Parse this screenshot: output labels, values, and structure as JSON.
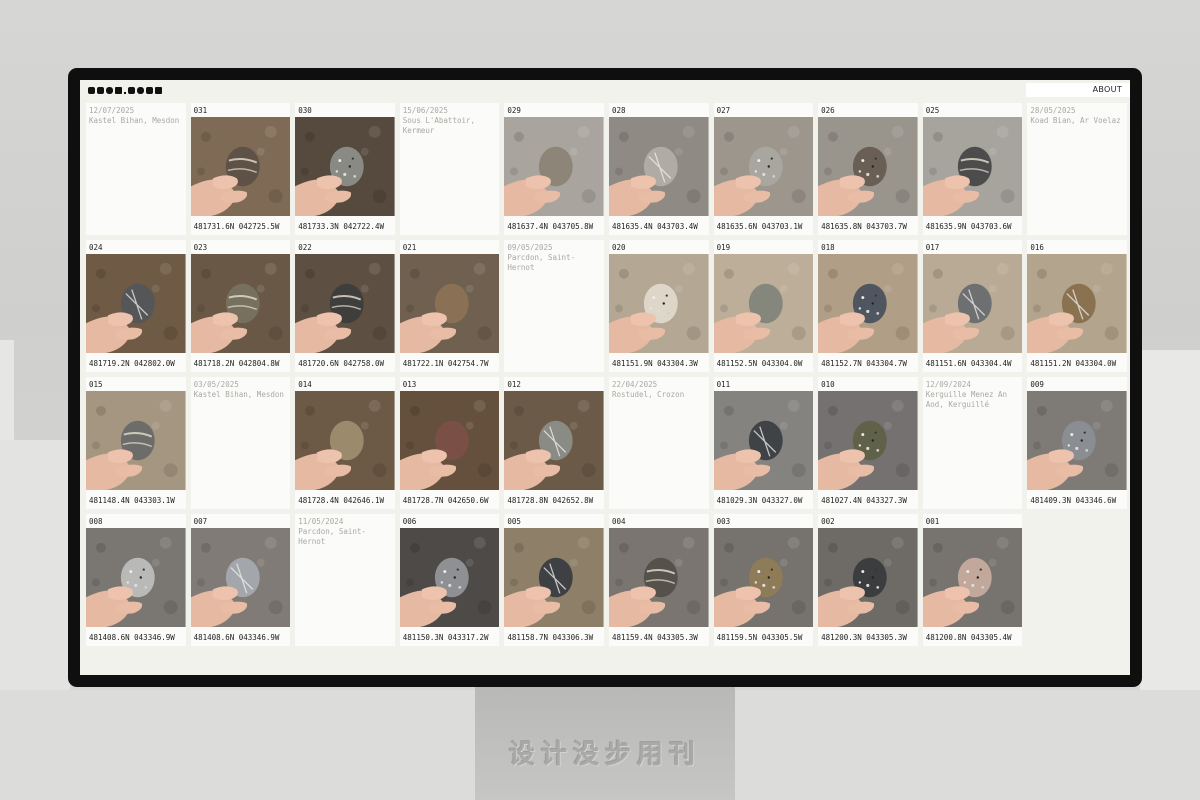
{
  "header": {
    "about_label": "ABOUT"
  },
  "watermark": "设计没步用刊",
  "colors": {
    "screen_bg": "#f2f2ed",
    "card_bg": "#fbfbf9",
    "muted_text": "#a8a8a4",
    "bezel": "#0f0f0f"
  },
  "cards": [
    {
      "kind": "info",
      "date": "12/07/2025",
      "place": "Kastel Bihan, Mesdon"
    },
    {
      "kind": "stone",
      "num": "031",
      "coords": "481731.6N 042725.5W",
      "ground": "#7e6a55",
      "stone": "#5e5246",
      "pattern": "stripe"
    },
    {
      "kind": "stone",
      "num": "030",
      "coords": "481733.3N 042722.4W",
      "ground": "#56493e",
      "stone": "#8a8a85",
      "pattern": "speck"
    },
    {
      "kind": "info",
      "date": "15/06/2025",
      "place": "Sous L'Abattoir, Kermeur"
    },
    {
      "kind": "stone",
      "num": "029",
      "coords": "481637.4N 043705.8W",
      "ground": "#a9a49d",
      "stone": "#8d8577",
      "pattern": "plain"
    },
    {
      "kind": "stone",
      "num": "028",
      "coords": "481635.4N 043703.4W",
      "ground": "#8f8a83",
      "stone": "#b0aca4",
      "pattern": "vein"
    },
    {
      "kind": "stone",
      "num": "027",
      "coords": "481635.6N 043703.1W",
      "ground": "#9c968d",
      "stone": "#a9a59f",
      "pattern": "speck"
    },
    {
      "kind": "stone",
      "num": "026",
      "coords": "481635.8N 043703.7W",
      "ground": "#99948c",
      "stone": "#6a5f55",
      "pattern": "speck"
    },
    {
      "kind": "stone",
      "num": "025",
      "coords": "481635.9N 043703.6W",
      "ground": "#a7a39d",
      "stone": "#4c4c4c",
      "pattern": "stripe"
    },
    {
      "kind": "info",
      "date": "28/05/2025",
      "place": "Koad Bian, Ar Voelaz"
    },
    {
      "kind": "stone",
      "num": "024",
      "coords": "481719.2N 042802.0W",
      "ground": "#6e5a45",
      "stone": "#545658",
      "pattern": "vein"
    },
    {
      "kind": "stone",
      "num": "023",
      "coords": "481718.2N 042804.8W",
      "ground": "#6a5846",
      "stone": "#77705e",
      "pattern": "stripe"
    },
    {
      "kind": "stone",
      "num": "022",
      "coords": "481720.6N 042758.0W",
      "ground": "#5d4f42",
      "stone": "#3e3e3c",
      "pattern": "stripe"
    },
    {
      "kind": "stone",
      "num": "021",
      "coords": "481722.1N 042754.7W",
      "ground": "#6f604f",
      "stone": "#8a7054",
      "pattern": "plain"
    },
    {
      "kind": "info",
      "date": "09/05/2025",
      "place": "Parcdon, Saint-Hernot"
    },
    {
      "kind": "stone",
      "num": "020",
      "coords": "481151.9N 043304.3W",
      "ground": "#b4a793",
      "stone": "#ded7c9",
      "pattern": "speck"
    },
    {
      "kind": "stone",
      "num": "019",
      "coords": "481152.5N 043304.0W",
      "ground": "#bcae98",
      "stone": "#86877c",
      "pattern": "plain"
    },
    {
      "kind": "stone",
      "num": "018",
      "coords": "481152.7N 043304.7W",
      "ground": "#b09f86",
      "stone": "#4f5660",
      "pattern": "speck"
    },
    {
      "kind": "stone",
      "num": "017",
      "coords": "481151.6N 043304.4W",
      "ground": "#b8aa94",
      "stone": "#6e6f70",
      "pattern": "vein"
    },
    {
      "kind": "stone",
      "num": "016",
      "coords": "481151.2N 043304.0W",
      "ground": "#b3a48d",
      "stone": "#8a7250",
      "pattern": "vein"
    },
    {
      "kind": "stone",
      "num": "015",
      "coords": "481148.4N 043303.1W",
      "ground": "#a49680",
      "stone": "#6c6d6b",
      "pattern": "stripe"
    },
    {
      "kind": "info",
      "date": "03/05/2025",
      "place": "Kastel Bihan, Mesdon"
    },
    {
      "kind": "stone",
      "num": "014",
      "coords": "481728.4N 042646.1W",
      "ground": "#6c5a46",
      "stone": "#9b8a6c",
      "pattern": "plain"
    },
    {
      "kind": "stone",
      "num": "013",
      "coords": "481728.7N 042650.6W",
      "ground": "#65503d",
      "stone": "#7a4f46",
      "pattern": "plain"
    },
    {
      "kind": "stone",
      "num": "012",
      "coords": "481728.8N 042652.8W",
      "ground": "#6b5a47",
      "stone": "#8a8b84",
      "pattern": "vein"
    },
    {
      "kind": "info",
      "date": "22/04/2025",
      "place": "Rostudel, Crozon"
    },
    {
      "kind": "stone",
      "num": "011",
      "coords": "481029.3N 043327.0W",
      "ground": "#858380",
      "stone": "#404346",
      "pattern": "vein"
    },
    {
      "kind": "stone",
      "num": "010",
      "coords": "481027.4N 043327.3W",
      "ground": "#747170",
      "stone": "#5f6148",
      "pattern": "speck"
    },
    {
      "kind": "info",
      "date": "12/09/2024",
      "place": "Kerguille Menez An Aod, Kerguillé"
    },
    {
      "kind": "stone",
      "num": "009",
      "coords": "481409.3N 043346.6W",
      "ground": "#7e7a76",
      "stone": "#8a8d92",
      "pattern": "speck"
    },
    {
      "kind": "stone",
      "num": "008",
      "coords": "481408.6N 043346.9W",
      "ground": "#7a7672",
      "stone": "#b9b9b7",
      "pattern": "speck"
    },
    {
      "kind": "stone",
      "num": "007",
      "coords": "481408.6N 043346.9W",
      "ground": "#807b76",
      "stone": "#a3a6ab",
      "pattern": "vein"
    },
    {
      "kind": "info",
      "date": "11/05/2024",
      "place": "Parcdon, Saint-Hernot"
    },
    {
      "kind": "stone",
      "num": "006",
      "coords": "481150.3N 043317.2W",
      "ground": "#4d4a47",
      "stone": "#8e9094",
      "pattern": "speck"
    },
    {
      "kind": "stone",
      "num": "005",
      "coords": "481158.7N 043306.3W",
      "ground": "#8e7f68",
      "stone": "#3f4044",
      "pattern": "vein"
    },
    {
      "kind": "stone",
      "num": "004",
      "coords": "481159.4N 043305.3W",
      "ground": "#7a7570",
      "stone": "#55524c",
      "pattern": "stripe"
    },
    {
      "kind": "stone",
      "num": "003",
      "coords": "481159.5N 043305.5W",
      "ground": "#76726d",
      "stone": "#8e7b58",
      "pattern": "speck"
    },
    {
      "kind": "stone",
      "num": "002",
      "coords": "481200.3N 043305.3W",
      "ground": "#6e6a65",
      "stone": "#3c3d3e",
      "pattern": "speck"
    },
    {
      "kind": "stone",
      "num": "001",
      "coords": "481200.8N 043305.4W",
      "ground": "#77736e",
      "stone": "#c2a89a",
      "pattern": "speck"
    }
  ]
}
